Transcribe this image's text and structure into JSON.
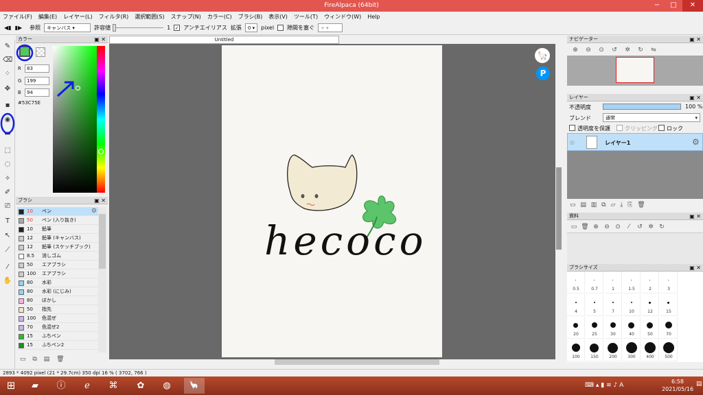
{
  "window": {
    "title": "FireAlpaca (64bit)",
    "min": "−",
    "max": "□",
    "close": "✕"
  },
  "menu": [
    "ファイル(F)",
    "編集(E)",
    "レイヤー(L)",
    "フィルタ(R)",
    "選択範囲(S)",
    "スナップ(N)",
    "カラー(C)",
    "ブラシ(B)",
    "表示(V)",
    "ツール(T)",
    "ウィンドウ(W)",
    "Help"
  ],
  "toolbar": {
    "ref_label": "参照",
    "ref_value": "キャンバス",
    "tolerance_label": "許容値",
    "tolerance_value": "1",
    "antialias_label": "アンチエイリアス",
    "expand_label": "拡張",
    "expand_value": "0",
    "expand_unit": "pixel",
    "gap_label": "隙間を塞ぐ",
    "gap_value": "+"
  },
  "color_panel": {
    "title": "カラー",
    "r_label": "R",
    "r": "83",
    "g_label": "G",
    "g": "199",
    "b_label": "B",
    "b": "94",
    "hex": "#53C75E",
    "current_color": "#53C75E"
  },
  "brush_panel": {
    "title": "ブラシ",
    "items": [
      {
        "size": "10",
        "name": "ペン",
        "color": "#222222",
        "selected": true
      },
      {
        "size": "50",
        "name": "ペン (入り抜き)",
        "color": "#aaaaaa"
      },
      {
        "size": "10",
        "name": "鉛筆",
        "color": "#222222"
      },
      {
        "size": "12",
        "name": "鉛筆 (キャンバス)",
        "color": "#cccccc"
      },
      {
        "size": "12",
        "name": "鉛筆 (スケッチブック)",
        "color": "#cccccc"
      },
      {
        "size": "8.5",
        "name": "消しゴム",
        "color": "#ffffff"
      },
      {
        "size": "50",
        "name": "エアブラシ",
        "color": "#cccccc"
      },
      {
        "size": "100",
        "name": "エアブラシ",
        "color": "#cccccc"
      },
      {
        "size": "80",
        "name": "水彩",
        "color": "#8fd3f5"
      },
      {
        "size": "80",
        "name": "水彩 (にじみ)",
        "color": "#8fd3f5"
      },
      {
        "size": "80",
        "name": "ぼかし",
        "color": "#f7b3e6"
      },
      {
        "size": "50",
        "name": "指先",
        "color": "#f7e0c8"
      },
      {
        "size": "100",
        "name": "色混ぜ",
        "color": "#c8b3f0"
      },
      {
        "size": "70",
        "name": "色混ぜ2",
        "color": "#c8b3f0"
      },
      {
        "size": "15",
        "name": "ふちペン",
        "color": "#33b533"
      },
      {
        "size": "15",
        "name": "ふちペン2",
        "color": "#1f8f1f"
      }
    ]
  },
  "document": {
    "tab": "Untitled",
    "artwork_text": "hecoco"
  },
  "navigator": {
    "title": "ナビゲーター"
  },
  "layer_panel": {
    "title": "レイヤー",
    "opacity_label": "不透明度",
    "opacity_value": "100 %",
    "opacity_fraction": 1.0,
    "blend_label": "ブレンド",
    "blend_value": "通常",
    "protect_label": "透明度を保護",
    "clipping_label": "クリッピング",
    "lock_label": "ロック",
    "layer_name": "レイヤー1"
  },
  "material_panel": {
    "title": "資料"
  },
  "brush_size_panel": {
    "title": "ブラシサイズ",
    "sizes": [
      "0.5",
      "0.7",
      "1",
      "1.5",
      "2",
      "3",
      "4",
      "5",
      "7",
      "10",
      "12",
      "15",
      "20",
      "25",
      "30",
      "40",
      "50",
      "70",
      "100",
      "150",
      "200",
      "300",
      "400",
      "500"
    ]
  },
  "status": "2893 * 4092 pixel   (21 * 29.7cm)   350 dpi   16 %   ( 3702, 766 )",
  "taskbar": {
    "time": "6:58",
    "date": "2021/05/16"
  }
}
